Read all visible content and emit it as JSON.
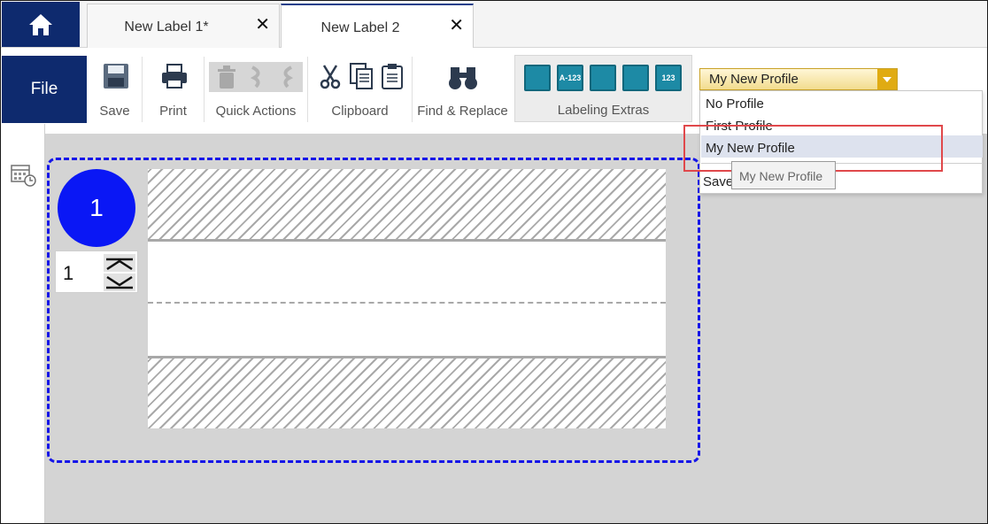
{
  "tabs": [
    {
      "label": "New Label 1*",
      "close": "✕"
    },
    {
      "label": "New Label 2",
      "close": "✕"
    }
  ],
  "ribbon": {
    "file_label": "File",
    "groups": {
      "save": "Save",
      "print": "Print",
      "quick_actions": "Quick Actions",
      "clipboard": "Clipboard",
      "find_replace": "Find & Replace",
      "labeling_extras": "Labeling Extras"
    },
    "extras_icons": [
      "",
      "A-123",
      "",
      "",
      "123"
    ]
  },
  "profile": {
    "selected": "My New Profile",
    "options": [
      "No Profile",
      "First Profile",
      "My New Profile"
    ],
    "footer_item": "Save",
    "tooltip": "My New Profile"
  },
  "label": {
    "number": "1",
    "stepper_value": "1"
  },
  "colors": {
    "brand_navy": "#0e2a6e",
    "label_border": "#1515e8",
    "circle_blue": "#0a17f5",
    "highlight_red": "#e0484b",
    "dropdown_gold": "#e0ab12"
  }
}
